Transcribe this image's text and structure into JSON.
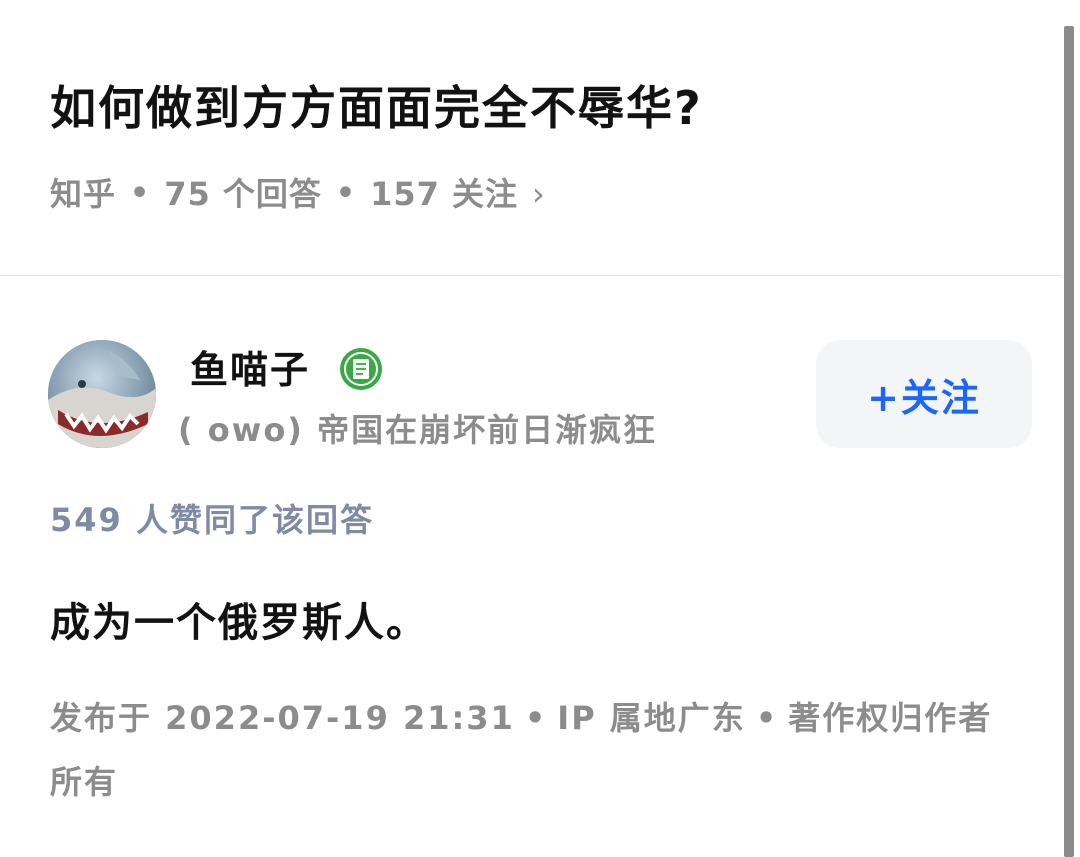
{
  "question": {
    "title": "如何做到方方面面完全不辱华?",
    "source": "知乎",
    "answers_count": "75 个回答",
    "followers_count": "157 关注",
    "chevron": "›"
  },
  "author": {
    "name": "鱼喵子",
    "badge_icon": "badge-icon",
    "bio": "( owo) 帝国在崩坏前日渐疯狂",
    "follow_label": "+关注"
  },
  "answer": {
    "votes": "549 人赞同了该回答",
    "content": "成为一个俄罗斯人。",
    "published": "发布于 2022-07-19 21:31",
    "ip": "IP 属地广东",
    "copyright": "著作权归作者所有"
  },
  "colors": {
    "accent": "#1a66ff",
    "badge_green": "#3aa845",
    "muted_text": "#8c8c8c",
    "vote_text": "#7f8aa3"
  }
}
